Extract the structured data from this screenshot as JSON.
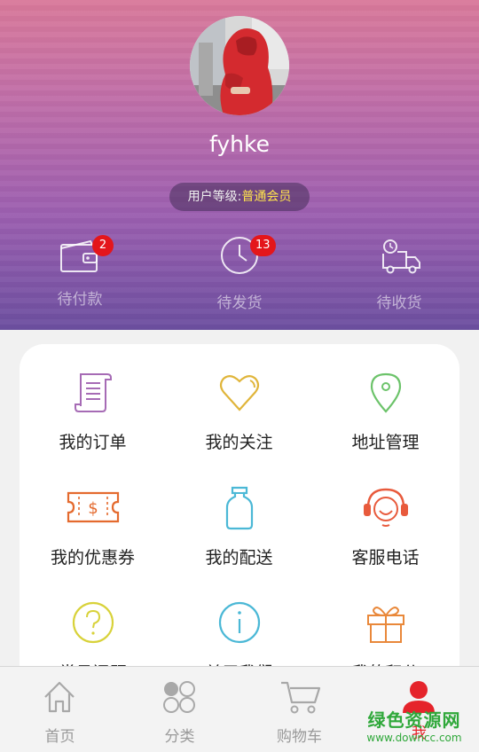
{
  "profile": {
    "username": "fyhke",
    "level_label": "用户等级:",
    "level_value": "普通会员"
  },
  "orders": [
    {
      "label": "待付款",
      "icon": "wallet-icon",
      "badge": "2"
    },
    {
      "label": "待发货",
      "icon": "clock-icon",
      "badge": "13"
    },
    {
      "label": "待收货",
      "icon": "delivery-truck-icon",
      "badge": ""
    }
  ],
  "menu": [
    {
      "label": "我的订单",
      "icon": "order-list-icon",
      "color": "#a66bb5"
    },
    {
      "label": "我的关注",
      "icon": "heart-icon",
      "color": "#e0b53a"
    },
    {
      "label": "地址管理",
      "icon": "location-pin-icon",
      "color": "#6cc36a"
    },
    {
      "label": "我的优惠券",
      "icon": "coupon-icon",
      "color": "#e46a2e"
    },
    {
      "label": "我的配送",
      "icon": "bottle-icon",
      "color": "#4bb8d6"
    },
    {
      "label": "客服电话",
      "icon": "customer-service-icon",
      "color": "#e85a3c"
    },
    {
      "label": "常见问题",
      "icon": "question-icon",
      "color": "#d8d23a"
    },
    {
      "label": "关于我们",
      "icon": "info-icon",
      "color": "#4bb8d6"
    },
    {
      "label": "我的积分",
      "icon": "gift-icon",
      "color": "#e9883a"
    }
  ],
  "tabs": [
    {
      "label": "首页",
      "icon": "home-icon"
    },
    {
      "label": "分类",
      "icon": "category-icon"
    },
    {
      "label": "购物车",
      "icon": "cart-icon"
    },
    {
      "label": "我",
      "icon": "user-icon"
    }
  ],
  "colors": {
    "accent": "#e5242b",
    "badge": "#e4161b",
    "level_value": "#ffe44d"
  },
  "watermark": {
    "cn": "绿色资源网",
    "en": "www.downcc.com"
  }
}
